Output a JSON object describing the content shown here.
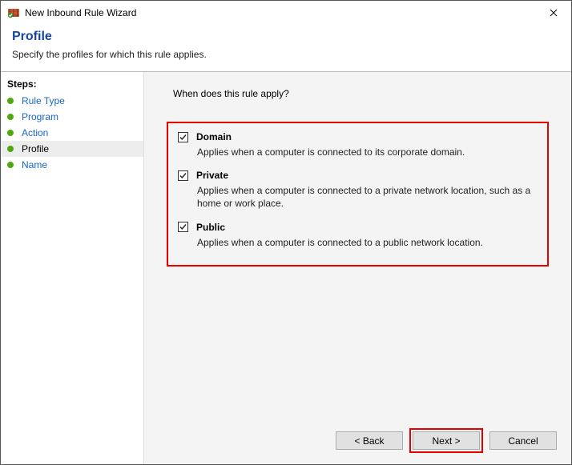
{
  "window": {
    "title": "New Inbound Rule Wizard"
  },
  "header": {
    "title": "Profile",
    "description": "Specify the profiles for which this rule applies."
  },
  "sidebar": {
    "title": "Steps:",
    "steps": [
      {
        "label": "Rule Type",
        "current": false
      },
      {
        "label": "Program",
        "current": false
      },
      {
        "label": "Action",
        "current": false
      },
      {
        "label": "Profile",
        "current": true
      },
      {
        "label": "Name",
        "current": false
      }
    ]
  },
  "content": {
    "question": "When does this rule apply?",
    "options": [
      {
        "name": "Domain",
        "checked": true,
        "description": "Applies when a computer is connected to its corporate domain."
      },
      {
        "name": "Private",
        "checked": true,
        "description": "Applies when a computer is connected to a private network location, such as a home or work place."
      },
      {
        "name": "Public",
        "checked": true,
        "description": "Applies when a computer is connected to a public network location."
      }
    ]
  },
  "footer": {
    "back": "< Back",
    "next": "Next >",
    "cancel": "Cancel"
  }
}
